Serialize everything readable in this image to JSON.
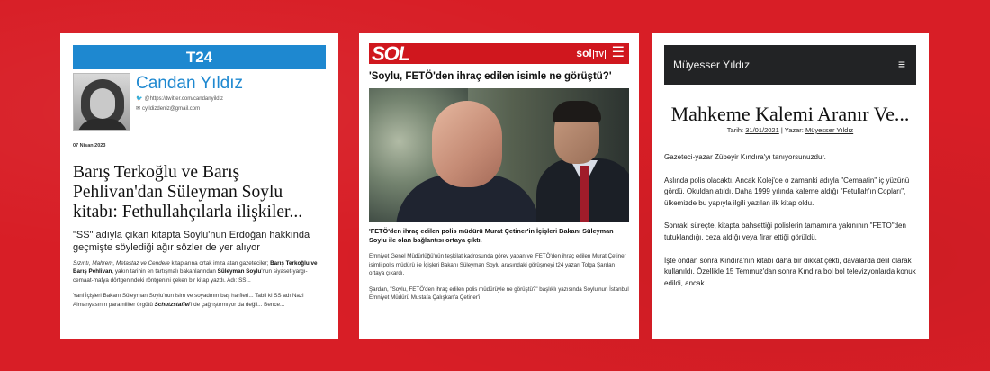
{
  "t24": {
    "site_name": "T24",
    "author_name": "Candan Yıldız",
    "twitter": "@https://twitter.com/candanyildiz",
    "email": "cyildizdeniz@gmail.com",
    "date": "07 Nisan 2023",
    "title": "Barış Terkoğlu ve Barış Pehlivan'dan Süleyman Soylu kitabı: Fethullahçılarla ilişkiler...",
    "subtitle": "\"SS\" adıyla çıkan kitapta Soylu'nun Erdoğan hakkında geçmişte söylediği ağır sözler de yer alıyor",
    "p1_italic": "Sızıntı, Mahrem, Metastaz ve Cendere",
    "p1_a": " kitaplarına ortak imza atan gazeteciler; ",
    "p1_b1": "Barış Terkoğlu ve Barış Pehlivan",
    "p1_c": ", yakın tarihin en tartışmalı bakanlarından ",
    "p1_b2": "Süleyman Soylu",
    "p1_d": "'nun siyaset-yargı-cemaat-mafya dörtgenindeki röntgenini çeken bir kitap yazdı. Adı: SS...",
    "p2_a": "Yani İçişleri Bakanı Süleyman Soylu'nun isim ve soyadının baş harfleri... Tabii ki SS adı Nazi Almanyasının paramiliter örgütü ",
    "p2_b": "Schutzstaffel",
    "p2_c": "'i de çağrıştırmıyor da değil... Bence..."
  },
  "sol": {
    "logo": "SOL",
    "tv_logo": "sol",
    "tv_badge": "TV",
    "headline": "'Soylu, FETÖ'den ihraç edilen isimle ne görüştü?'",
    "caption": "'FETÖ'den ihraç edilen polis müdürü Murat Çetiner'in İçişleri Bakanı Süleyman Soylu ile olan bağlantısı ortaya çıktı.",
    "p1": "Emniyet Genel Müdürlüğü'nün teşkilat kadrosunda görev yapan ve 'FETÖ'den ihraç edilen Murat Çetiner isimli polis müdürü ile İçişleri Bakanı Süleyman Soylu arasındaki görüşmeyi t24 yazarı Tolga Şardan ortaya çıkardı.",
    "p2": "Şardan, \"Soylu, FETÖ'den ihraç edilen polis müdürüyle ne görüştü?\" başlıklı yazısında Soylu'nun İstanbul Emniyet Müdürü Mustafa Çalışkan'a Çetiner'i"
  },
  "blog": {
    "site_title": "Müyesser Yıldız",
    "title": "Mahkeme Kalemi Aranır Ve...",
    "date_label": "Tarih: ",
    "date": "31/01/2021",
    "author_label": " | Yazar: ",
    "author": "Müyesser Yıldız",
    "p1": "Gazeteci-yazar Zübeyir Kındıra'yı tanıyorsunuzdur.",
    "p2": "Aslında polis olacaktı. Ancak Kolej'de o zamanki adıyla \"Cemaatin\" iç yüzünü gördü. Okuldan atıldı. Daha 1999 yılında kaleme aldığı \"Fetullah'ın Copları\", ülkemizde bu yapıyla ilgili yazılan ilk kitap oldu.",
    "p3": "Sonraki süreçte, kitapta bahsettiği polislerin tamamına yakınının \"FETÖ\"den tutuklandığı, ceza aldığı veya firar ettiği görüldü.",
    "p4": "İşte ondan sonra Kındıra'nın kitabı daha bir dikkat çekti, davalarda delil olarak kullanıldı. Özellikle 15 Temmuz'dan sonra Kındıra bol bol televizyonlarda konuk edildi, ancak"
  },
  "colors": {
    "background": "#d81e26",
    "t24_blue": "#1e88d0",
    "sol_red": "#d0171e",
    "blog_dark": "#222325"
  }
}
